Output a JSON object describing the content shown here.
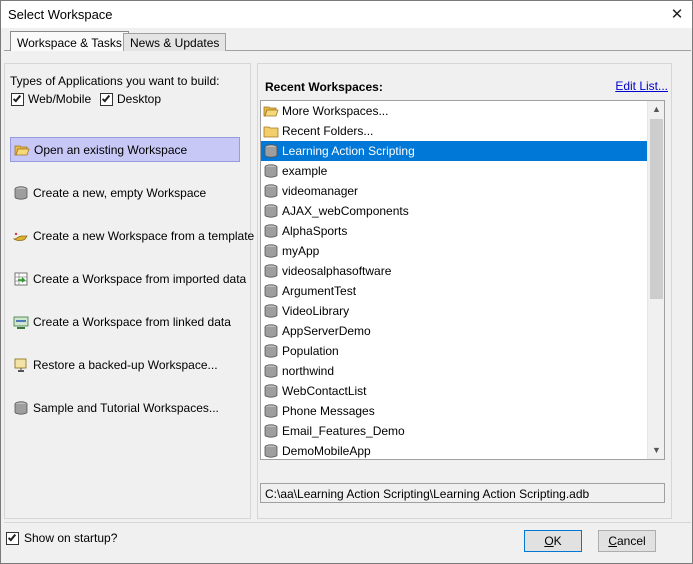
{
  "window": {
    "title": "Select Workspace",
    "close_glyph": "✕"
  },
  "tabs": [
    {
      "label": "Workspace & Tasks",
      "active": true
    },
    {
      "label": "News & Updates",
      "active": false
    }
  ],
  "left": {
    "types_label": "Types of Applications you want to build:",
    "checkboxes": [
      {
        "label": "Web/Mobile",
        "checked": true
      },
      {
        "label": "Desktop",
        "checked": true
      }
    ],
    "tasks": [
      {
        "label": "Open an existing Workspace",
        "icon": "folder-open-icon",
        "selected": true
      },
      {
        "label": "Create a new, empty Workspace",
        "icon": "database-icon",
        "selected": false
      },
      {
        "label": "Create a new Workspace from a template",
        "icon": "magic-lamp-icon",
        "selected": false
      },
      {
        "label": "Create a Workspace from imported data",
        "icon": "import-data-icon",
        "selected": false
      },
      {
        "label": "Create a Workspace from linked data",
        "icon": "linked-data-icon",
        "selected": false
      },
      {
        "label": "Restore a backed-up Workspace...",
        "icon": "restore-icon",
        "selected": false
      },
      {
        "label": "Sample and Tutorial Workspaces...",
        "icon": "database-icon",
        "selected": false
      }
    ]
  },
  "right": {
    "recent_label": "Recent Workspaces:",
    "edit_link": "Edit List...",
    "items": [
      {
        "label": "More Workspaces...",
        "icon": "folder-open-icon"
      },
      {
        "label": "Recent Folders...",
        "icon": "folder-icon"
      },
      {
        "label": "Learning Action Scripting",
        "icon": "database-icon",
        "selected": true
      },
      {
        "label": "example",
        "icon": "database-icon"
      },
      {
        "label": "videomanager",
        "icon": "database-icon"
      },
      {
        "label": "AJAX_webComponents",
        "icon": "database-icon"
      },
      {
        "label": "AlphaSports",
        "icon": "database-icon"
      },
      {
        "label": "myApp",
        "icon": "database-icon"
      },
      {
        "label": "videosalphasoftware",
        "icon": "database-icon"
      },
      {
        "label": "ArgumentTest",
        "icon": "database-icon"
      },
      {
        "label": "VideoLibrary",
        "icon": "database-icon"
      },
      {
        "label": "AppServerDemo",
        "icon": "database-icon"
      },
      {
        "label": "Population",
        "icon": "database-icon"
      },
      {
        "label": "northwind",
        "icon": "database-icon"
      },
      {
        "label": "WebContactList",
        "icon": "database-icon"
      },
      {
        "label": "Phone Messages",
        "icon": "database-icon"
      },
      {
        "label": "Email_Features_Demo",
        "icon": "database-icon"
      },
      {
        "label": "DemoMobileApp",
        "icon": "database-icon"
      }
    ],
    "path": "C:\\aa\\Learning Action Scripting\\Learning Action Scripting.adb"
  },
  "footer": {
    "startup_label": "Show on startup?",
    "startup_checked": true,
    "ok_label": "OK",
    "cancel_label": "Cancel"
  },
  "colors": {
    "selection": "#0078d7",
    "task_selection": "#c8c8f7",
    "link": "#0000cc"
  }
}
